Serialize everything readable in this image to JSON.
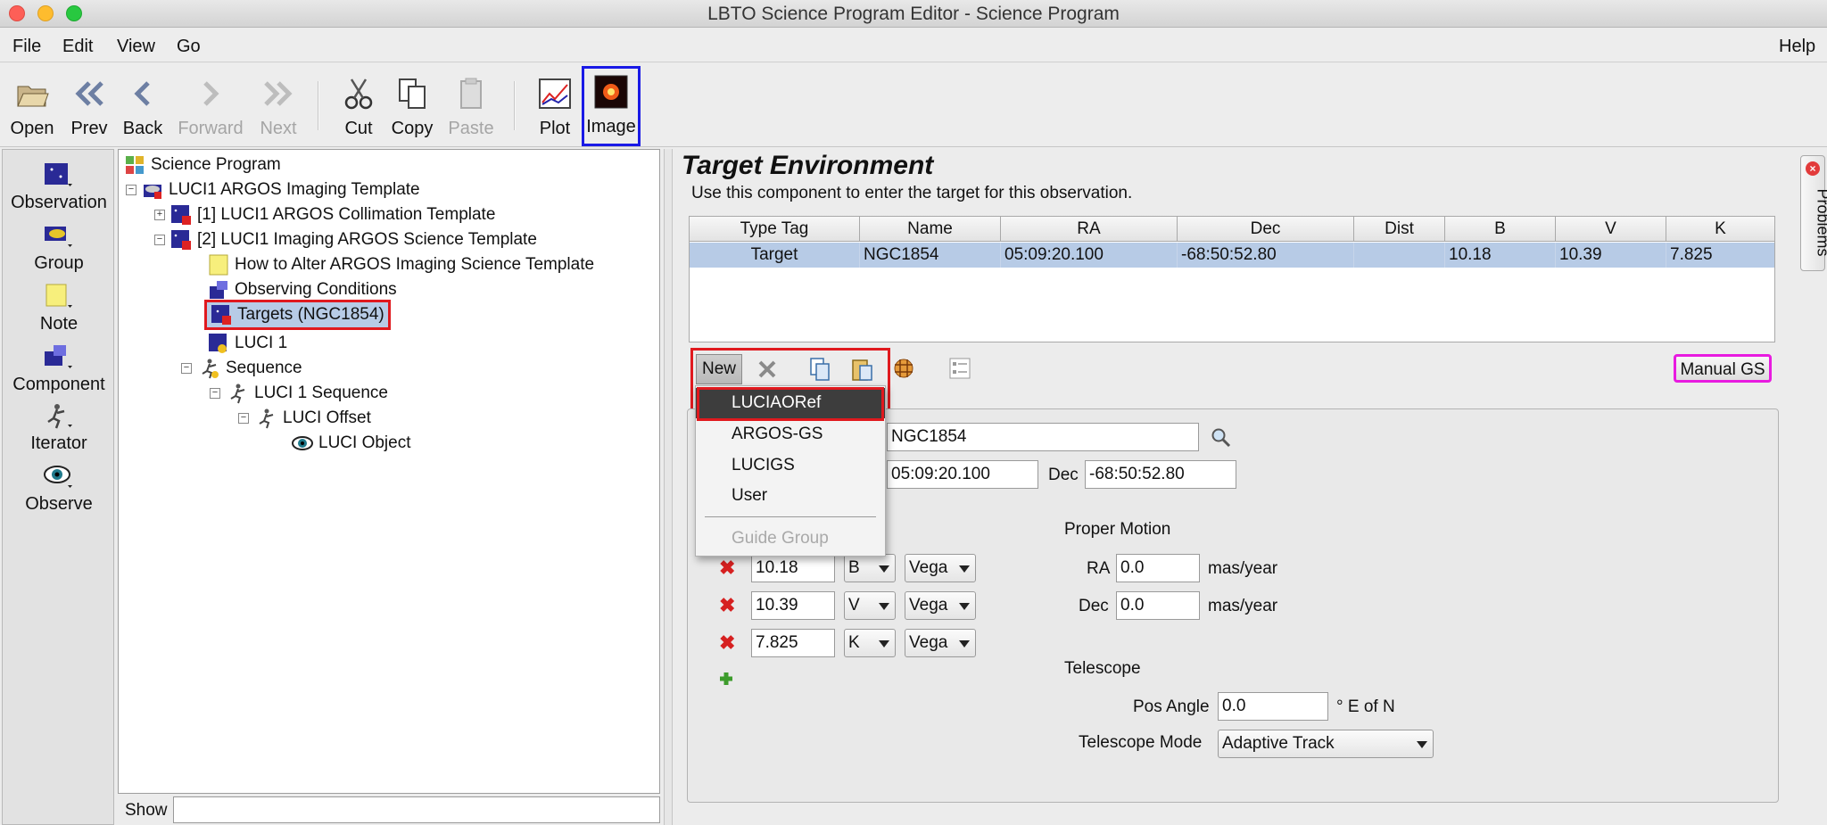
{
  "window": {
    "title": "LBTO Science Program Editor - Science Program"
  },
  "menu": {
    "file": "File",
    "edit": "Edit",
    "view": "View",
    "go": "Go",
    "help": "Help"
  },
  "toolbar": {
    "open": "Open",
    "prev": "Prev",
    "back": "Back",
    "forward": "Forward",
    "next": "Next",
    "cut": "Cut",
    "copy": "Copy",
    "paste": "Paste",
    "plot": "Plot",
    "image": "Image"
  },
  "palette": [
    "Observation",
    "Group",
    "Note",
    "Component",
    "Iterator",
    "Observe"
  ],
  "tree": {
    "root": "Science Program",
    "items": [
      "LUCI1 ARGOS Imaging Template",
      "[1] LUCI1 ARGOS Collimation Template",
      "[2] LUCI1 Imaging ARGOS Science Template",
      "How to Alter ARGOS Imaging Science Template",
      "Observing Conditions",
      "Targets (NGC1854)",
      "LUCI 1",
      "Sequence",
      "LUCI 1 Sequence",
      "LUCI Offset",
      "LUCI Object"
    ],
    "show_label": "Show",
    "show_value": ""
  },
  "env": {
    "title": "Target Environment",
    "subtitle": "Use this component to enter the target for this observation."
  },
  "table": {
    "headers": [
      "Type Tag",
      "Name",
      "RA",
      "Dec",
      "Dist",
      "B",
      "V",
      "K"
    ],
    "row": [
      "Target",
      "NGC1854",
      "05:09:20.100",
      "-68:50:52.80",
      "",
      "10.18",
      "10.39",
      "7.825"
    ]
  },
  "buttons": {
    "new": "New",
    "manual_gs": "Manual GS"
  },
  "popup": {
    "items": [
      "LUCIAORef",
      "ARGOS-GS",
      "LUCIGS",
      "User"
    ],
    "disabled": "Guide Group"
  },
  "form": {
    "name_value": "NGC1854",
    "ra_value": "05:09:20.100",
    "dec_label": "Dec",
    "dec_value": "-68:50:52.80",
    "magnitudes": [
      {
        "value": "10.18",
        "band": "B",
        "system": "Vega"
      },
      {
        "value": "10.39",
        "band": "V",
        "system": "Vega"
      },
      {
        "value": "7.825",
        "band": "K",
        "system": "Vega"
      }
    ],
    "proper_motion": {
      "title": "Proper Motion",
      "ra_label": "RA",
      "ra_value": "0.0",
      "dec_label": "Dec",
      "dec_value": "0.0",
      "unit": "mas/year"
    },
    "telescope": {
      "title": "Telescope",
      "pos_angle_label": "Pos Angle",
      "pos_angle_value": "0.0",
      "pos_angle_unit": "° E of N",
      "mode_label": "Telescope Mode",
      "mode_value": "Adaptive Track"
    }
  },
  "problems_tab": "Problems",
  "colors": {
    "selection": "#b7cbe6",
    "highlight_red": "#e0191e",
    "highlight_blue": "#1a1ae6",
    "highlight_magenta": "#e81be0"
  }
}
